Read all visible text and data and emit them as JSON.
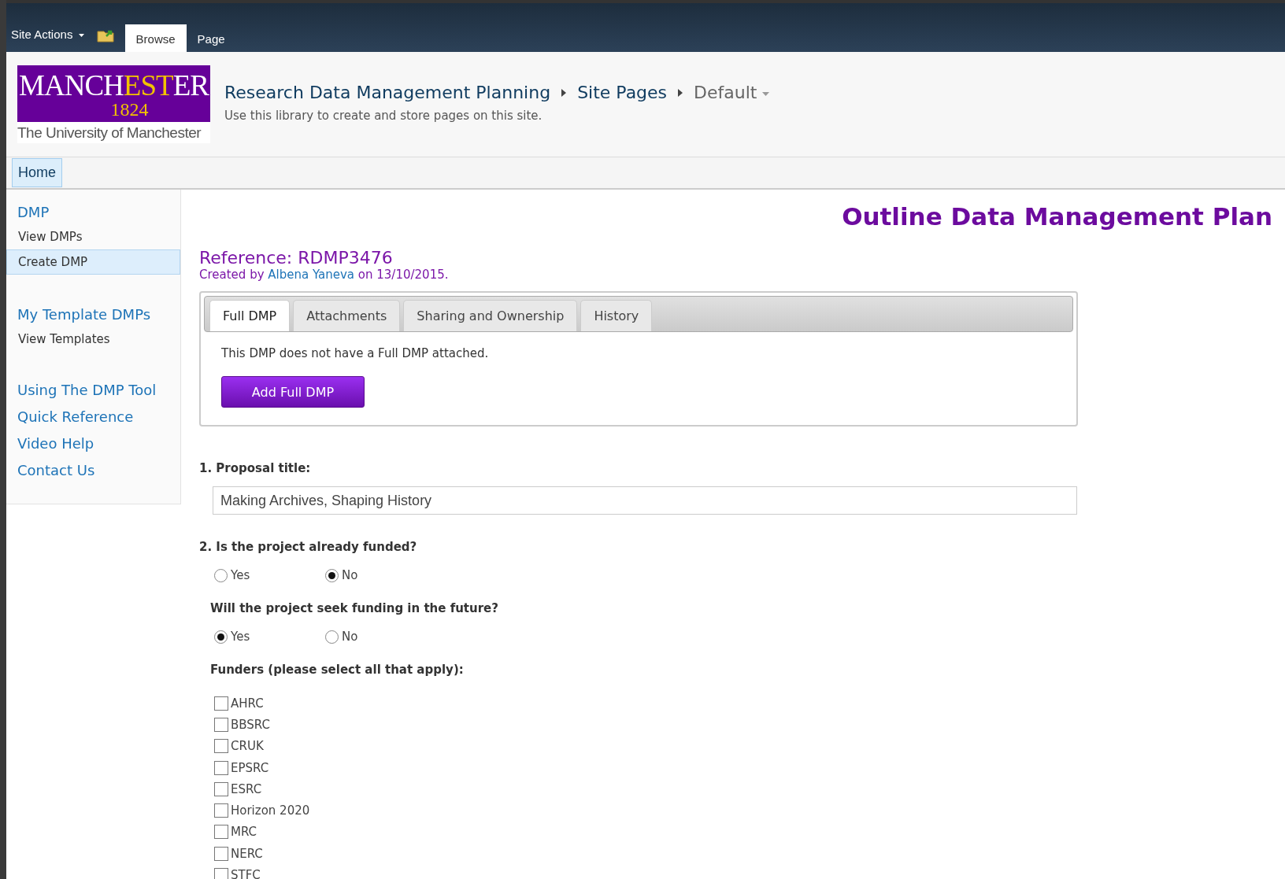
{
  "top_bar": {
    "site_actions": "Site Actions",
    "tabs": [
      {
        "label": "Browse",
        "selected": true
      },
      {
        "label": "Page",
        "selected": false
      }
    ]
  },
  "header": {
    "logo": {
      "name_start": "MANCH",
      "name_middle": "EST",
      "name_end": "ER",
      "year": "1824",
      "caption": "The University of Manchester"
    },
    "breadcrumb": [
      "Research Data Management Planning",
      "Site Pages"
    ],
    "current": "Default",
    "description": "Use this library to create and store pages on this site."
  },
  "nav": [
    {
      "label": "Home",
      "selected": true
    }
  ],
  "sidebar": {
    "groups": [
      {
        "heading": "DMP",
        "items": [
          {
            "label": "View DMPs",
            "selected": false
          },
          {
            "label": "Create DMP",
            "selected": true
          }
        ]
      },
      {
        "heading": "My Template DMPs",
        "items": [
          {
            "label": "View Templates",
            "selected": false
          }
        ]
      }
    ],
    "links": [
      "Using The DMP Tool",
      "Quick Reference",
      "Video Help",
      "Contact Us"
    ]
  },
  "content": {
    "title": "Outline Data Management Plan",
    "reference": "Reference: RDMP3476",
    "created_prefix": "Created by",
    "author": "Albena Yaneva",
    "created_suffix": "on 13/10/2015.",
    "tabs": [
      {
        "label": "Full DMP",
        "selected": true
      },
      {
        "label": "Attachments",
        "selected": false
      },
      {
        "label": "Sharing and Ownership",
        "selected": false
      },
      {
        "label": "History",
        "selected": false
      }
    ],
    "tab_message": "This DMP does not have a Full DMP attached.",
    "add_button": "Add Full DMP",
    "proposal": {
      "label": "1. Proposal title:",
      "value": "Making Archives, Shaping History"
    },
    "funded": {
      "question": "2. Is the project already funded?",
      "options": [
        {
          "label": "Yes",
          "selected": false
        },
        {
          "label": "No",
          "selected": true
        }
      ]
    },
    "future": {
      "question": "Will the project seek funding in the future?",
      "options": [
        {
          "label": "Yes",
          "selected": true
        },
        {
          "label": "No",
          "selected": false
        }
      ]
    },
    "funders": {
      "label": "Funders (please select all that apply):",
      "options": [
        {
          "label": "AHRC",
          "checked": false
        },
        {
          "label": "BBSRC",
          "checked": false
        },
        {
          "label": "CRUK",
          "checked": false
        },
        {
          "label": "EPSRC",
          "checked": false
        },
        {
          "label": "ESRC",
          "checked": false
        },
        {
          "label": "Horizon 2020",
          "checked": false
        },
        {
          "label": "MRC",
          "checked": false
        },
        {
          "label": "NERC",
          "checked": false
        },
        {
          "label": "STFC",
          "checked": false
        }
      ]
    }
  }
}
